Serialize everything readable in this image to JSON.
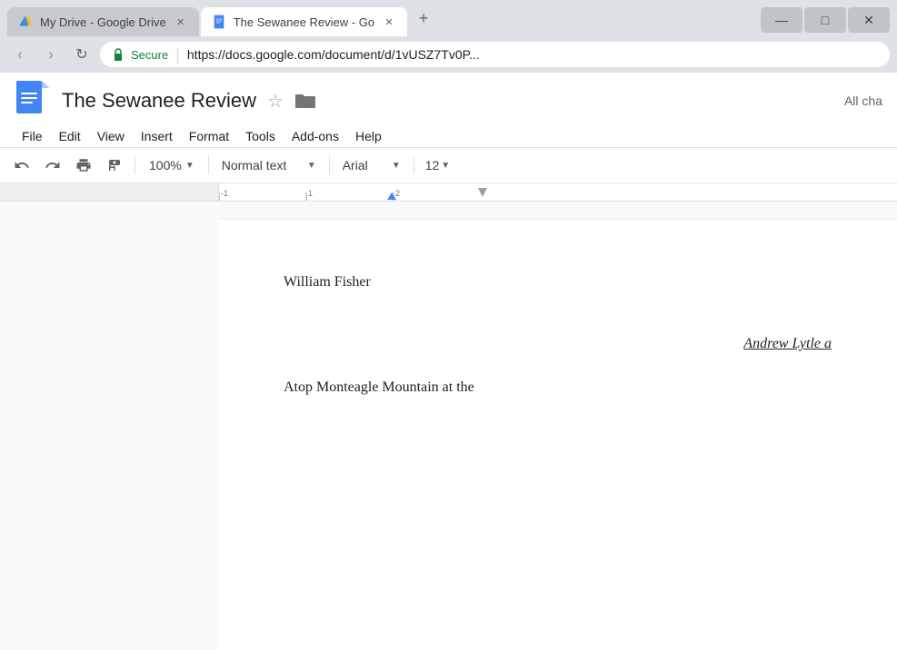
{
  "browser": {
    "tabs": [
      {
        "id": "tab-drive",
        "title": "My Drive - Google Drive",
        "icon_type": "drive",
        "active": false,
        "url": ""
      },
      {
        "id": "tab-docs",
        "title": "The Sewanee Review - Go",
        "icon_type": "docs",
        "active": true,
        "url": ""
      }
    ],
    "window_control_label": "□",
    "address": {
      "secure_label": "Secure",
      "url": "https://docs.google.com/document/d/1vUSZ7Tv0P..."
    },
    "nav": {
      "back_label": "‹",
      "forward_label": "›",
      "reload_label": "↻"
    }
  },
  "docs": {
    "title": "The Sewanee Review",
    "star_label": "☆",
    "folder_label": "🗁",
    "all_changes_label": "All cha",
    "menu": [
      {
        "label": "File"
      },
      {
        "label": "Edit"
      },
      {
        "label": "View"
      },
      {
        "label": "Insert"
      },
      {
        "label": "Format"
      },
      {
        "label": "Tools"
      },
      {
        "label": "Add-ons"
      },
      {
        "label": "Help"
      }
    ]
  },
  "toolbar": {
    "undo_label": "↩",
    "redo_label": "↪",
    "print_label": "🖨",
    "paint_label": "🖌",
    "zoom_label": "100%",
    "style_label": "Normal text",
    "font_label": "Arial",
    "size_label": "12"
  },
  "document": {
    "author": "William Fisher",
    "title_italic": "Andrew Lytle a",
    "body_text": "Atop Monteagle Mountain at the"
  }
}
